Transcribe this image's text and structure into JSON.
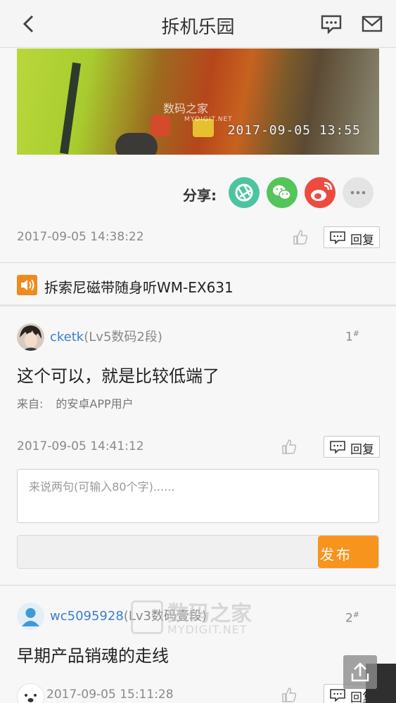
{
  "header": {
    "title": "拆机乐园"
  },
  "photo": {
    "watermark": "数码之家",
    "watermark_sub": "MYDIGIT.NET",
    "stamp": "2017-09-05  13:55"
  },
  "share": {
    "label": "分享:",
    "targets": [
      "camera-share",
      "wechat",
      "weibo",
      "more"
    ]
  },
  "post": {
    "date": "2017-09-05 14:38:22",
    "reply_label": "回复"
  },
  "topic": {
    "title": "拆索尼磁带随身听WM-EX631"
  },
  "comments": [
    {
      "user": "cketk",
      "level": "(Lv5数码2段)",
      "floor": "1",
      "floor_mark": "#",
      "text": "这个可以，就是比较低端了",
      "from_label": "来自:",
      "from_value": "的安卓APP用户",
      "date": "2017-09-05 14:41:12",
      "reply_label": "回复"
    },
    {
      "user": "wc5095928",
      "level": "(Lv3数码壹段)",
      "floor": "2",
      "floor_mark": "#",
      "text": "早期产品销魂的走线",
      "date": "2017-09-05 15:11:28",
      "reply_label": "回复"
    }
  ],
  "reply_form": {
    "placeholder": "来说两句(可输入80个字)......",
    "submit_label": "发布"
  },
  "overlay_watermark": {
    "text": "数码之家",
    "sub": "MYDIGIT.NET"
  },
  "colors": {
    "accent": "#f7941e",
    "link": "#3a7fd0"
  }
}
